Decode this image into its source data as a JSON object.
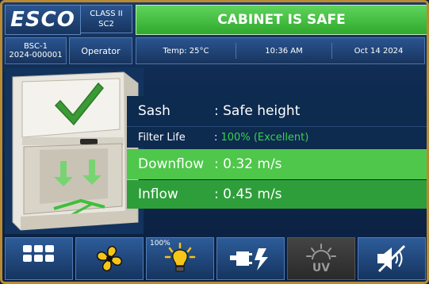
{
  "header": {
    "logo": "ESCO",
    "class_line1": "CLASS II",
    "class_line2": "SC2",
    "status": "CABINET IS SAFE"
  },
  "info": {
    "cabinet_id": "BSC-1",
    "serial": "2024-000001",
    "user": "Operator",
    "temperature": "Temp: 25°C",
    "time": "10:36 AM",
    "date": "Oct 14 2024"
  },
  "status_rows": {
    "sash_label": "Sash",
    "sash_value": ": Safe height",
    "filter_label": "Filter Life",
    "filter_prefix": ": ",
    "filter_value": "100% (Excellent)",
    "downflow_label": "Downflow",
    "downflow_value": ": 0.32 m/s",
    "inflow_label": "Inflow",
    "inflow_value": ": 0.45 m/s"
  },
  "toolbar": {
    "light_level": "100%",
    "buttons": [
      "menu-grid-icon",
      "fan-icon",
      "light-bulb-icon",
      "power-plug-icon",
      "uv-lamp-icon",
      "mute-icon"
    ]
  },
  "colors": {
    "safe_green": "#3fbf3c",
    "downflow_green": "#4ec74a",
    "inflow_green": "#2e9e3a",
    "frame_gold": "#b98a32"
  }
}
